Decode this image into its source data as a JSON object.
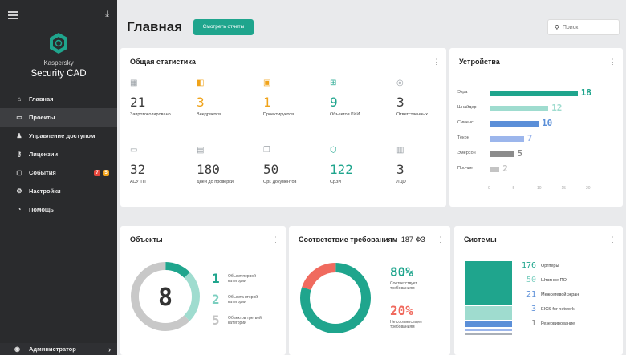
{
  "sidebar": {
    "brand_small": "Kaspersky",
    "brand_big": "Security CAD",
    "items": [
      {
        "label": "Главная",
        "icon": "home-icon",
        "glyph": "⌂"
      },
      {
        "label": "Проекты",
        "icon": "folder-icon",
        "glyph": "▭"
      },
      {
        "label": "Управление доступом",
        "icon": "users-icon",
        "glyph": "♟"
      },
      {
        "label": "Лицензии",
        "icon": "key-icon",
        "glyph": "⚷"
      },
      {
        "label": "События",
        "icon": "message-icon",
        "glyph": "▢"
      },
      {
        "label": "Настройки",
        "icon": "gear-icon",
        "glyph": "⚙"
      },
      {
        "label": "Помощь",
        "icon": "help-icon",
        "glyph": "◔"
      }
    ],
    "event_badges": [
      "7",
      "5"
    ],
    "user": "Администратор"
  },
  "header": {
    "title": "Главная",
    "reports_button": "Смотреть отчеты",
    "search_placeholder": "Поиск"
  },
  "stats": {
    "title": "Общая статистика",
    "items": [
      {
        "value": "21",
        "label": "Запротоколировано",
        "icon": "grid-icon",
        "glyph": "▦",
        "color": "#9aa0a6"
      },
      {
        "value": "3",
        "label": "Внедряется",
        "icon": "document-icon",
        "glyph": "◧",
        "color": "#f0a31a"
      },
      {
        "value": "1",
        "label": "Проектируется",
        "icon": "window-icon",
        "glyph": "▣",
        "color": "#f0a31a"
      },
      {
        "value": "9",
        "label": "Объектов КИИ",
        "icon": "network-icon",
        "glyph": "⊞",
        "color": "#1fa58d"
      },
      {
        "value": "3",
        "label": "Ответственных",
        "icon": "user-circle-icon",
        "glyph": "◎",
        "color": "#9aa0a6"
      },
      {
        "value": "32",
        "label": "АСУ ТП",
        "icon": "monitor-icon",
        "glyph": "▭",
        "color": "#9aa0a6"
      },
      {
        "value": "180",
        "label": "Дней до проверки",
        "icon": "calendar-icon",
        "glyph": "▤",
        "color": "#9aa0a6"
      },
      {
        "value": "50",
        "label": "Орг. документов",
        "icon": "documents-icon",
        "glyph": "❐",
        "color": "#9aa0a6"
      },
      {
        "value": "122",
        "label": "СрЗИ",
        "icon": "shield-icon",
        "glyph": "⬡",
        "color": "#1fa58d"
      },
      {
        "value": "3",
        "label": "ЛЦО",
        "icon": "id-card-icon",
        "glyph": "▥",
        "color": "#9aa0a6"
      }
    ]
  },
  "devices": {
    "title": "Устройства",
    "color_accent": "#1fa58d",
    "ticks": [
      "0",
      "5",
      "10",
      "15",
      "20"
    ]
  },
  "chart_data": [
    {
      "type": "bar",
      "orientation": "horizontal",
      "title": "Устройства",
      "categories": [
        "Экра",
        "Шнайдер",
        "Сименс",
        "Текон",
        "Эмерсон",
        "Прочие"
      ],
      "values": [
        18,
        12,
        10,
        7,
        5,
        2
      ],
      "colors": [
        "#1fa58d",
        "#9fdccf",
        "#5b8fd8",
        "#9cb6ec",
        "#8c8c8c",
        "#c4c4c4"
      ],
      "xlim": [
        0,
        20
      ],
      "x_ticks": [
        0,
        5,
        10,
        15,
        20
      ]
    },
    {
      "type": "pie",
      "title": "Объекты",
      "center_label": "8",
      "series": [
        {
          "name": "Объект первой категории",
          "value": 1,
          "color": "#1fa58d"
        },
        {
          "name": "Объекта второй категории",
          "value": 2,
          "color": "#9fdccf"
        },
        {
          "name": "Объектов третьей категории",
          "value": 5,
          "color": "#c8c8c8"
        }
      ]
    },
    {
      "type": "pie",
      "title": "Соответствие требованиям 187 ФЗ",
      "series": [
        {
          "name": "Соответствует требованиям",
          "value": 80,
          "color": "#1fa58d"
        },
        {
          "name": "Не соответствует требованиям",
          "value": 20,
          "color": "#f06a5e"
        }
      ]
    },
    {
      "type": "bar",
      "orientation": "stacked",
      "title": "Системы",
      "categories": [
        "Оргперы",
        "Штатное ПО",
        "Межсетевой экран",
        "EICS for network",
        "Резервирование"
      ],
      "values": [
        176,
        50,
        21,
        3,
        1
      ],
      "colors": [
        "#1fa58d",
        "#9fdccf",
        "#5b8fd8",
        "#9cb6ec",
        "#aab0b8"
      ]
    }
  ],
  "objects": {
    "title": "Объекты",
    "center": "8",
    "legend": [
      {
        "num": "1",
        "label": "Объект первой категории",
        "color": "#1fa58d"
      },
      {
        "num": "2",
        "label": "Объекта второй категории",
        "color": "#7ccfc0"
      },
      {
        "num": "5",
        "label": "Объектов третьей категории",
        "color": "#c4c4c4"
      }
    ]
  },
  "compliance": {
    "title": "Соответствие требованиям",
    "law": "187 ФЗ",
    "ok_pct": "80%",
    "ok_label": "Соответствует требованиям",
    "bad_pct": "20%",
    "bad_label": "Не соответствует требованиям"
  },
  "systems": {
    "title": "Системы",
    "rows": [
      {
        "num": "176",
        "label": "Оргперы",
        "color": "#1fa58d"
      },
      {
        "num": "50",
        "label": "Штатное ПО",
        "color": "#7ccfc0"
      },
      {
        "num": "21",
        "label": "Межсетевой экран",
        "color": "#5b8fd8"
      },
      {
        "num": "3",
        "label": "EICS for network",
        "color": "#5b8fd8"
      },
      {
        "num": "1",
        "label": "Резервирование",
        "color": "#888888"
      }
    ]
  }
}
